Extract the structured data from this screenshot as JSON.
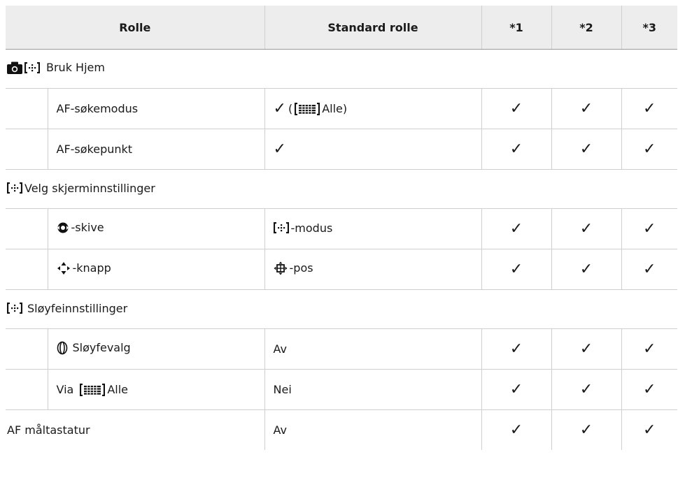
{
  "header": {
    "role": "Rolle",
    "standard": "Standard rolle",
    "c1": "*1",
    "c2": "*2",
    "c3": "*3"
  },
  "check_symbol": "✓",
  "sections": {
    "s1": {
      "title": "Bruk Hjem",
      "icons": [
        "camera-icon",
        "af-target-icon"
      ]
    },
    "s2": {
      "title": "Velg skjerminnstillinger",
      "icons": [
        "af-target-icon"
      ]
    },
    "s3": {
      "title": "Sløyfeinnstillinger",
      "icons": [
        "af-target-icon"
      ]
    }
  },
  "rows": {
    "r1": {
      "role": "AF-søkemodus",
      "std_open": "(",
      "std_label": "Alle)"
    },
    "r2": {
      "role": "AF-søkepunkt"
    },
    "r3": {
      "role": "-skive",
      "std": "-modus"
    },
    "r4": {
      "role": "-knapp",
      "std": "-pos"
    },
    "r5": {
      "role": "Sløyfevalg",
      "std": "Av"
    },
    "r6": {
      "role_prefix": "Via",
      "role_label": "Alle",
      "std": "Nei"
    },
    "r7": {
      "role": "AF måltastatur",
      "std": "Av"
    }
  }
}
